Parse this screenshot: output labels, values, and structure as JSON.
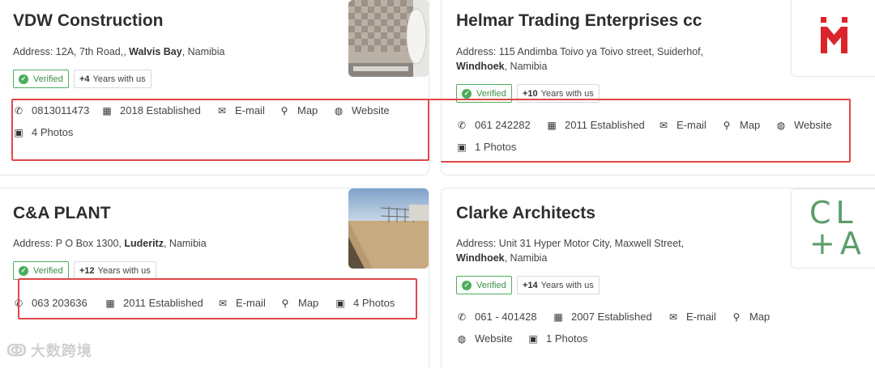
{
  "cards": [
    {
      "title": "VDW Construction",
      "address_prefix": "Address: 12A, 7th Road,, ",
      "address_bold": "Walvis Bay",
      "address_suffix": ", Namibia",
      "verified": "Verified",
      "years_plus": "+4",
      "years_label": "Years with us",
      "phone": "0813011473",
      "established": "2018 Established",
      "email": "E-mail",
      "map": "Map",
      "website": "Website",
      "photos": "4 Photos"
    },
    {
      "title": "Helmar Trading Enterprises cc",
      "address_line1": "Address: 115 Andimba Toivo ya Toivo street, Suiderhof,",
      "address_bold": "Windhoek",
      "address_suffix": ", Namibia",
      "verified": "Verified",
      "years_plus": "+10",
      "years_label": "Years with us",
      "phone": "061 242282",
      "established": "2011 Established",
      "email": "E-mail",
      "map": "Map",
      "website": "Website",
      "photos": "1 Photos"
    },
    {
      "title": "C&A PLANT",
      "address_prefix": "Address: P O Box 1300, ",
      "address_bold": "Luderitz",
      "address_suffix": ", Namibia",
      "verified": "Verified",
      "years_plus": "+12",
      "years_label": "Years with us",
      "phone": "063 203636",
      "established": "2011 Established",
      "email": "E-mail",
      "map": "Map",
      "photos": "4 Photos"
    },
    {
      "title": "Clarke Architects",
      "address_line1": "Address: Unit 31 Hyper Motor City, Maxwell Street,",
      "address_bold": "Windhoek",
      "address_suffix": ", Namibia",
      "verified": "Verified",
      "years_plus": "+14",
      "years_label": "Years with us",
      "phone": "061 - 401428",
      "established": "2007 Established",
      "email": "E-mail",
      "map": "Map",
      "website": "Website",
      "photos": "1 Photos",
      "logo_text_top": "CL",
      "logo_text_bottom": "+A"
    }
  ],
  "watermark": "大数跨境",
  "colors": {
    "verified_green": "#4cae5b",
    "highlight_red": "#e04848",
    "helmar_logo_red": "#d9252b",
    "clarke_logo_green": "#5a9e6a"
  },
  "icons": {
    "phone": "phone-icon",
    "calendar": "calendar-icon",
    "email": "envelope-icon",
    "map": "map-marker-icon",
    "website": "globe-icon",
    "photos": "image-icon",
    "verified": "check-circle-icon"
  }
}
